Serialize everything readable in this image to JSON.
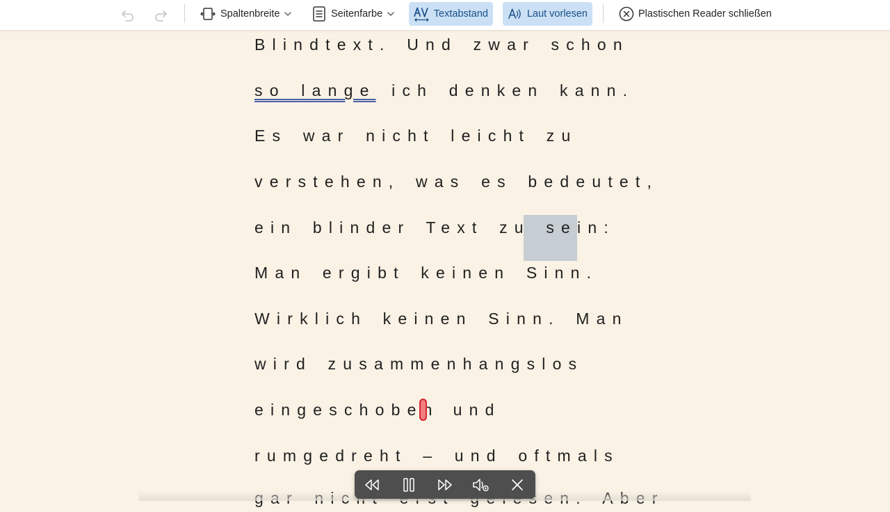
{
  "toolbar": {
    "undo_icon": "undo-icon",
    "redo_icon": "redo-icon",
    "column_width_label": "Spaltenbreite",
    "page_color_label": "Seitenfarbe",
    "text_spacing_label": "Textabstand",
    "read_aloud_label": "Laut vorlesen",
    "close_label": "Plastischen Reader schließen",
    "active_color": "#cbe0f4"
  },
  "reader": {
    "lines": [
      "Blindtext. Und zwar schon",
      "so lange",
      "ich denken kann.",
      "Es war nicht leicht zu",
      "verstehen, was es bedeutet,",
      "ein blinder Text zu sein:",
      "Man ergibt keinen Sinn.",
      "Wirklich keinen Sinn. Man",
      "wird zusammenhangslos",
      "eingeschoben",
      "und",
      "rumgedreht – und oftmals",
      "gar nicht erst gelesen. Aber"
    ],
    "background_color": "#f9f2e5",
    "highlight_color": "#c6cdd3"
  },
  "player": {
    "buttons": [
      "rewind-icon",
      "pause-icon",
      "fast-forward-icon",
      "voice-settings-icon",
      "close-icon"
    ]
  }
}
